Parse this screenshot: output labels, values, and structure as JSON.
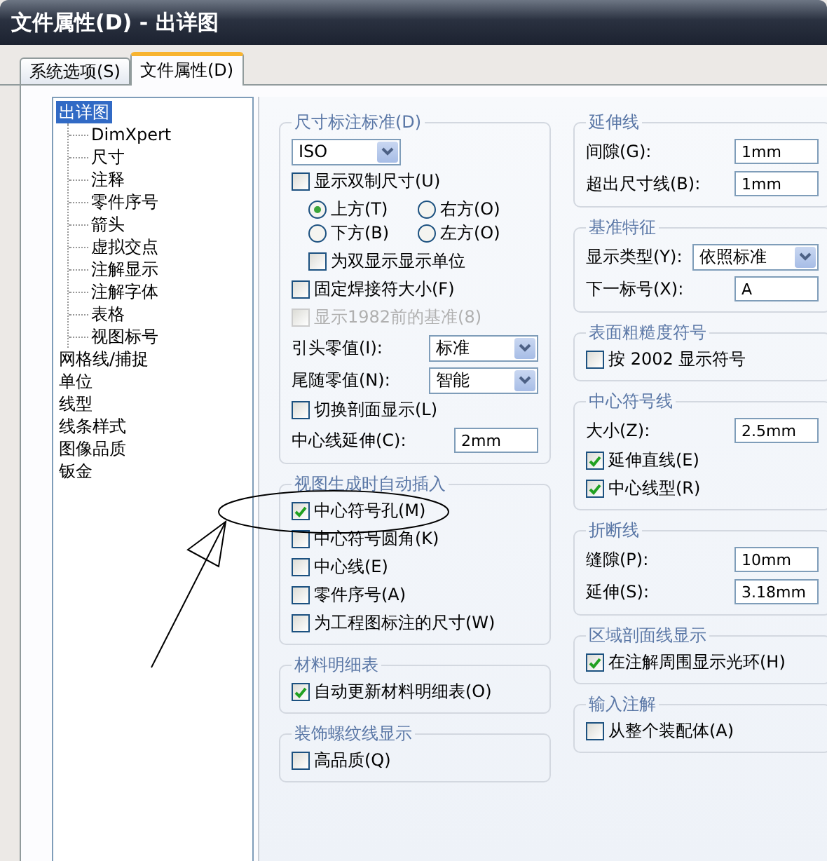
{
  "window": {
    "title": "文件属性(D) - 出详图"
  },
  "tabs": [
    {
      "label": "系统选项(S)",
      "selected": false
    },
    {
      "label": "文件属性(D)",
      "selected": true
    }
  ],
  "tree": [
    {
      "label": "出详图",
      "selected": true,
      "children": [
        {
          "label": "DimXpert",
          "selected": false
        },
        {
          "label": "尺寸",
          "selected": false
        },
        {
          "label": "注释",
          "selected": false
        },
        {
          "label": "零件序号",
          "selected": false
        },
        {
          "label": "箭头",
          "selected": false
        },
        {
          "label": "虚拟交点",
          "selected": false
        },
        {
          "label": "注解显示",
          "selected": false
        },
        {
          "label": "注解字体",
          "selected": false
        },
        {
          "label": "表格",
          "selected": false
        },
        {
          "label": "视图标号",
          "selected": false
        }
      ]
    },
    {
      "label": "网格线/捕捉",
      "selected": false
    },
    {
      "label": "单位",
      "selected": false
    },
    {
      "label": "线型",
      "selected": false
    },
    {
      "label": "线条样式",
      "selected": false
    },
    {
      "label": "图像品质",
      "selected": false
    },
    {
      "label": "钣金",
      "selected": false
    }
  ],
  "left_groups": [
    {
      "title": "尺寸标注标准(D)",
      "items": [
        {
          "kind": "dropdown",
          "value": "ISO"
        },
        {
          "kind": "checkbox",
          "label": "显示双制尺寸(U)",
          "checked": false,
          "disabled": false
        },
        {
          "kind": "radios",
          "options": [
            {
              "label": "上方(T)",
              "selected": true
            },
            {
              "label": "右方(O)",
              "selected": false
            },
            {
              "label": "下方(B)",
              "selected": false
            },
            {
              "label": "左方(O)",
              "selected": false
            }
          ]
        },
        {
          "kind": "sub_checkbox",
          "label": "为双显示显示单位",
          "checked": false,
          "disabled": false
        },
        {
          "kind": "checkbox",
          "label": "固定焊接符大小(F)",
          "checked": false,
          "disabled": false
        },
        {
          "kind": "checkbox",
          "label": "显示1982前的基准(8)",
          "checked": false,
          "disabled": true
        },
        {
          "kind": "dropdown",
          "label": "引头零值(I):",
          "value": "标准"
        },
        {
          "kind": "dropdown",
          "label": "尾随零值(N):",
          "value": "智能"
        },
        {
          "kind": "checkbox",
          "label": "切换剖面显示(L)",
          "checked": false,
          "disabled": false
        },
        {
          "kind": "field",
          "label": "中心线延伸(C):",
          "value": "2mm"
        }
      ]
    },
    {
      "title": "视图生成时自动插入",
      "items": [
        {
          "kind": "checkbox",
          "label": "中心符号孔(M)",
          "checked": true,
          "disabled": false
        },
        {
          "kind": "checkbox",
          "label": "中心符号圆角(K)",
          "checked": false,
          "disabled": false
        },
        {
          "kind": "checkbox",
          "label": "中心线(E)",
          "checked": false,
          "disabled": false
        },
        {
          "kind": "checkbox",
          "label": "零件序号(A)",
          "checked": false,
          "disabled": false
        },
        {
          "kind": "checkbox",
          "label": "为工程图标注的尺寸(W)",
          "checked": false,
          "disabled": false
        }
      ]
    },
    {
      "title": "材料明细表",
      "items": [
        {
          "kind": "checkbox",
          "label": "自动更新材料明细表(O)",
          "checked": true,
          "disabled": false
        }
      ]
    },
    {
      "title": "装饰螺纹线显示",
      "items": [
        {
          "kind": "checkbox",
          "label": "高品质(Q)",
          "checked": false,
          "disabled": false
        }
      ]
    }
  ],
  "right_groups": [
    {
      "title": "延伸线",
      "items": [
        {
          "kind": "field",
          "label": "间隙(G):",
          "value": "1mm"
        },
        {
          "kind": "field",
          "label": "超出尺寸线(B):",
          "value": "1mm"
        }
      ]
    },
    {
      "title": "基准特征",
      "items": [
        {
          "kind": "dropdown",
          "label": "显示类型(Y):",
          "value": "依照标准"
        },
        {
          "kind": "field",
          "label": "下一标号(X):",
          "value": "A"
        }
      ]
    },
    {
      "title": "表面粗糙度符号",
      "items": [
        {
          "kind": "checkbox",
          "label": "按 2002 显示符号",
          "checked": false,
          "disabled": false
        }
      ]
    },
    {
      "title": "中心符号线",
      "items": [
        {
          "kind": "field",
          "label": "大小(Z):",
          "value": "2.5mm"
        },
        {
          "kind": "checkbox",
          "label": "延伸直线(E)",
          "checked": true,
          "disabled": false
        },
        {
          "kind": "checkbox",
          "label": "中心线型(R)",
          "checked": true,
          "disabled": false
        }
      ]
    },
    {
      "title": "折断线",
      "items": [
        {
          "kind": "field",
          "label": "缝隙(P):",
          "value": "10mm"
        },
        {
          "kind": "field",
          "label": "延伸(S):",
          "value": "3.18mm"
        }
      ]
    },
    {
      "title": "区域剖面线显示",
      "items": [
        {
          "kind": "checkbox",
          "label": "在注解周围显示光环(H)",
          "checked": true,
          "disabled": false
        }
      ]
    },
    {
      "title": "输入注解",
      "items": [
        {
          "kind": "checkbox",
          "label": "从整个装配体(A)",
          "checked": false,
          "disabled": false
        }
      ]
    }
  ]
}
